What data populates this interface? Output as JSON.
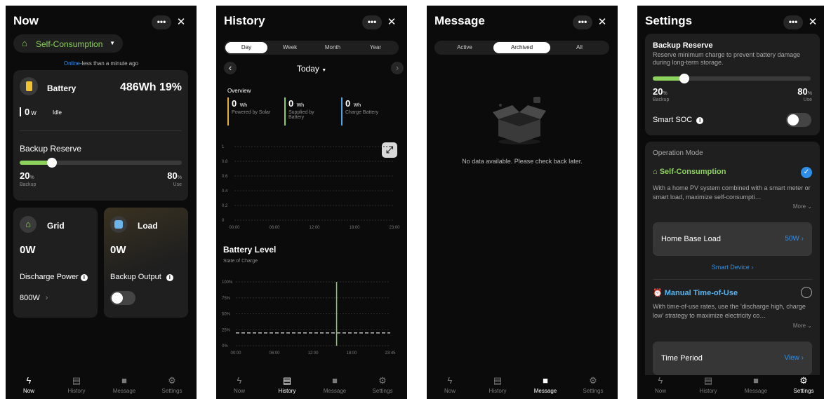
{
  "nav": {
    "now": "Now",
    "history": "History",
    "message": "Message",
    "settings": "Settings"
  },
  "header": {
    "more": "•••",
    "close": "✕"
  },
  "now": {
    "title": "Now",
    "mode": "Self-Consumption",
    "status_online": "Online",
    "status_rest": "-less than a minute ago",
    "battery": {
      "label": "Battery",
      "value": "486Wh 19%",
      "power_value": "0",
      "power_unit": "W",
      "state": "Idle"
    },
    "backup_reserve": {
      "label": "Backup Reserve",
      "backup_value": "20",
      "backup_unit": "%",
      "backup_label": "Backup",
      "use_value": "80",
      "use_unit": "%",
      "use_label": "Use",
      "level_fraction": 0.2
    },
    "grid": {
      "label": "Grid",
      "value": "0W",
      "sub_label": "Discharge Power",
      "sub_value": "800W",
      "chevron": "›"
    },
    "load": {
      "label": "Load",
      "value": "0W",
      "sub_label": "Backup Output",
      "toggle_on": false
    }
  },
  "history": {
    "title": "History",
    "tabs": [
      "Day",
      "Week",
      "Month",
      "Year"
    ],
    "selected_tab": 0,
    "date": "Today",
    "overview_label": "Overview",
    "stats": [
      {
        "value": "0",
        "unit": "Wh",
        "label1": "Powered by Solar",
        "label2": "",
        "color": "#e8b23a"
      },
      {
        "value": "0",
        "unit": "Wh",
        "label1": "Supplied by",
        "label2": "Battery",
        "color": "#8cd15c"
      },
      {
        "value": "0",
        "unit": "Wh",
        "label1": "Charge Battery",
        "label2": "",
        "color": "#4fa3e0"
      }
    ],
    "chart_data": [
      {
        "type": "line",
        "yticks": [
          "0",
          "0.2",
          "0.4",
          "0.6",
          "0.8",
          "1"
        ],
        "xticks": [
          "00:00",
          "06:00",
          "12:00",
          "18:00",
          "23:00"
        ],
        "ylim": [
          0,
          1
        ],
        "series": []
      },
      {
        "type": "line",
        "title": "Battery Level",
        "subtitle": "State of Charge",
        "yticks": [
          "0%",
          "25%",
          "50%",
          "75%",
          "100%"
        ],
        "xticks": [
          "00:00",
          "06:00",
          "12:00",
          "18:00",
          "23:45"
        ],
        "ylim": [
          0,
          100
        ],
        "reserve_line": 20,
        "marker_hour": 15.5,
        "colors": {
          "marker": "#8cd15c",
          "reserve": "#ffffff"
        }
      }
    ]
  },
  "message": {
    "title": "Message",
    "tabs": [
      "Active",
      "Archived",
      "All"
    ],
    "selected_tab": 1,
    "empty_text": "No data available. Please check back later."
  },
  "settings": {
    "title": "Settings",
    "backup_reserve": {
      "title": "Backup Reserve",
      "desc": "Reserve minimum charge to prevent battery damage during long-term storage.",
      "backup_value": "20",
      "backup_unit": "%",
      "backup_label": "Backup",
      "use_value": "80",
      "use_unit": "%",
      "use_label": "Use",
      "level_fraction": 0.2
    },
    "smart_soc": {
      "label": "Smart SOC",
      "toggle_on": false
    },
    "operation_mode": {
      "label": "Operation Mode",
      "self_consumption": {
        "title": "Self-Consumption",
        "desc": "With a home PV system combined with a smart meter or smart load, maximize self-consumpti…",
        "more": "More",
        "selected": true
      },
      "home_base_load": {
        "label": "Home Base Load",
        "value": "50W",
        "chevron": "›"
      },
      "smart_device": "Smart Device",
      "time_of_use": {
        "title": "Manual Time-of-Use",
        "desc": "With time-of-use rates, use the 'discharge high, charge low' strategy to maximize electricity co…",
        "more": "More",
        "selected": false
      },
      "time_period": {
        "label": "Time Period",
        "value": "View",
        "chevron": "›"
      }
    }
  },
  "colors": {
    "accent_green": "#8cd15c",
    "link_blue": "#2f8fe8",
    "background": "#0b0b0b",
    "card": "#1f1f1f"
  }
}
